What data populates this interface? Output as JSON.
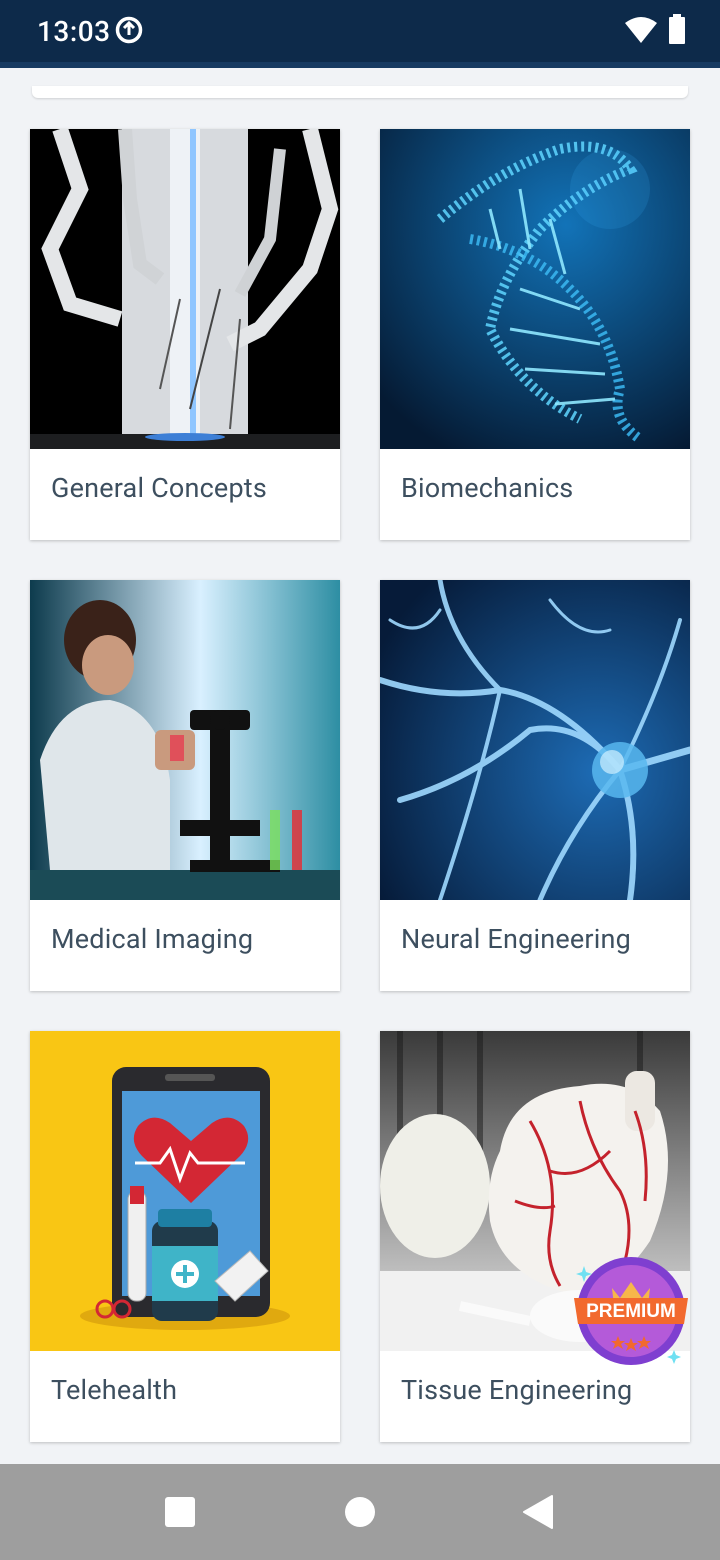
{
  "status_bar": {
    "time": "13:03"
  },
  "topics": [
    {
      "label": "General Concepts"
    },
    {
      "label": "Biomechanics"
    },
    {
      "label": "Medical Imaging"
    },
    {
      "label": "Neural Engineering"
    },
    {
      "label": "Telehealth"
    },
    {
      "label": "Tissue Engineering"
    }
  ],
  "premium_badge": {
    "label": "PREMIUM"
  },
  "colors": {
    "status_bar": "#0d2a4a",
    "background": "#f1f3f6",
    "label_text": "#3d4f5f",
    "nav_bar": "#9e9e9e"
  }
}
